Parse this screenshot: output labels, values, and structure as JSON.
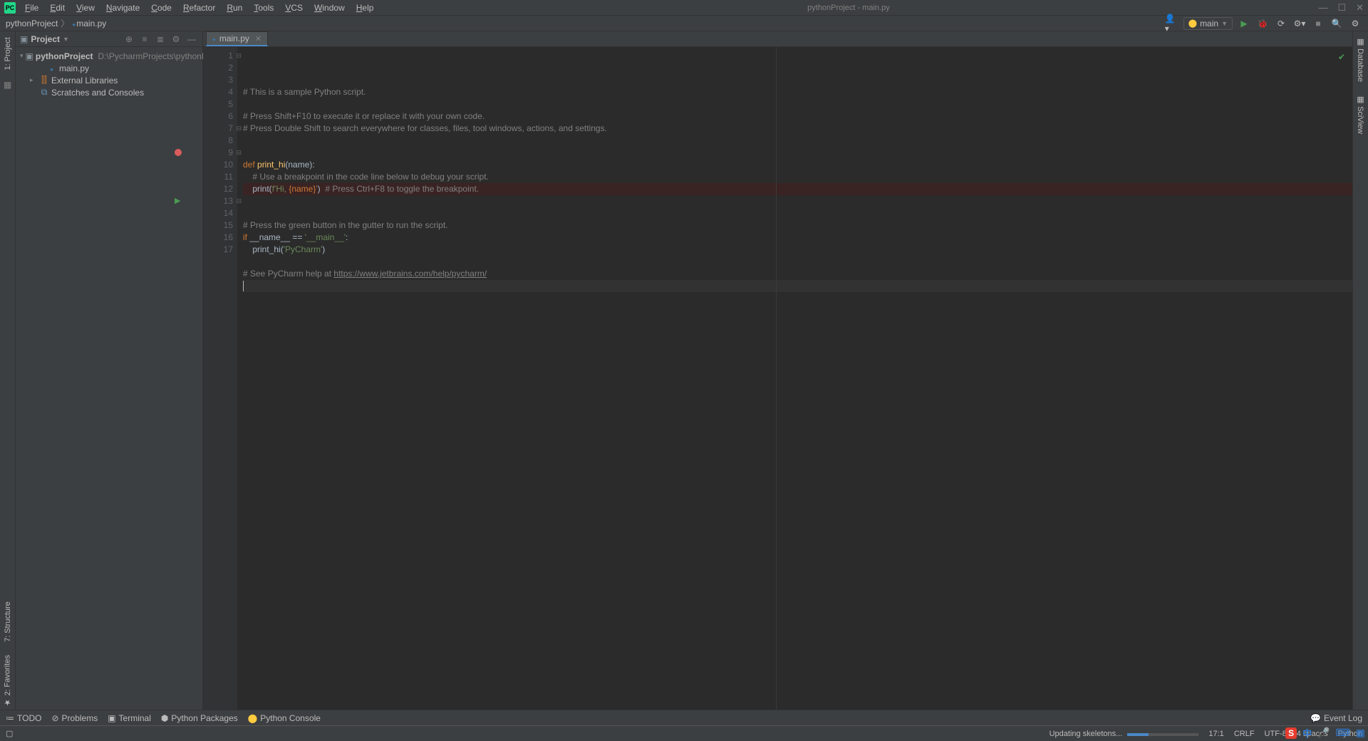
{
  "window": {
    "title": "pythonProject - main.py",
    "menus": [
      "File",
      "Edit",
      "View",
      "Navigate",
      "Code",
      "Refactor",
      "Run",
      "Tools",
      "VCS",
      "Window",
      "Help"
    ]
  },
  "breadcrumb": {
    "project": "pythonProject",
    "file": "main.py"
  },
  "runConfig": {
    "name": "main"
  },
  "projectPanel": {
    "title": "Project",
    "root": {
      "name": "pythonProject",
      "path": "D:\\PycharmProjects\\pythonProject"
    },
    "file": "main.py",
    "extLibs": "External Libraries",
    "scratches": "Scratches and Consoles"
  },
  "tabs": [
    {
      "label": "main.py",
      "active": true
    }
  ],
  "code": {
    "lines": [
      {
        "n": 1,
        "tokens": [
          {
            "t": "# This is a sample Python script.",
            "c": "c-comment"
          }
        ],
        "fold": true
      },
      {
        "n": 2,
        "tokens": []
      },
      {
        "n": 3,
        "tokens": [
          {
            "t": "# Press Shift+F10 to execute it or replace it with your own code.",
            "c": "c-comment"
          }
        ]
      },
      {
        "n": 4,
        "tokens": [
          {
            "t": "# Press Double Shift to search everywhere for classes, files, tool windows, actions, and settings.",
            "c": "c-comment"
          }
        ]
      },
      {
        "n": 5,
        "tokens": []
      },
      {
        "n": 6,
        "tokens": []
      },
      {
        "n": 7,
        "tokens": [
          {
            "t": "def ",
            "c": "c-kw"
          },
          {
            "t": "print_hi",
            "c": "c-fn"
          },
          {
            "t": "(name):",
            "c": ""
          }
        ],
        "fold": true
      },
      {
        "n": 8,
        "tokens": [
          {
            "t": "    # Use a breakpoint in the code line below to debug your script.",
            "c": "c-comment"
          }
        ]
      },
      {
        "n": 9,
        "tokens": [
          {
            "t": "    print(",
            "c": ""
          },
          {
            "t": "f'Hi, ",
            "c": "c-str"
          },
          {
            "t": "{name}",
            "c": "c-kw"
          },
          {
            "t": "'",
            "c": "c-str"
          },
          {
            "t": ")  ",
            "c": ""
          },
          {
            "t": "# Press Ctrl+F8 to toggle the breakpoint.",
            "c": "c-comment"
          }
        ],
        "bp": true,
        "fold": true
      },
      {
        "n": 10,
        "tokens": []
      },
      {
        "n": 11,
        "tokens": []
      },
      {
        "n": 12,
        "tokens": [
          {
            "t": "# Press the green button in the gutter to run the script.",
            "c": "c-comment"
          }
        ]
      },
      {
        "n": 13,
        "tokens": [
          {
            "t": "if ",
            "c": "c-kw"
          },
          {
            "t": "__name__ == ",
            "c": ""
          },
          {
            "t": "'__main__'",
            "c": "c-str"
          },
          {
            "t": ":",
            "c": ""
          }
        ],
        "run": true,
        "fold": true
      },
      {
        "n": 14,
        "tokens": [
          {
            "t": "    print_hi(",
            "c": ""
          },
          {
            "t": "'PyCharm'",
            "c": "c-str"
          },
          {
            "t": ")",
            "c": ""
          }
        ]
      },
      {
        "n": 15,
        "tokens": []
      },
      {
        "n": 16,
        "tokens": [
          {
            "t": "# See PyCharm help at ",
            "c": "c-comment"
          },
          {
            "t": "https://www.jetbrains.com/help/pycharm/",
            "c": "c-link"
          }
        ]
      },
      {
        "n": 17,
        "tokens": [],
        "cursor": true
      }
    ]
  },
  "leftRail": {
    "project": "Project",
    "structure": "Structure",
    "favorites": "Favorites"
  },
  "rightRail": {
    "database": "Database",
    "sciview": "SciView"
  },
  "bottomTools": {
    "todo": "TODO",
    "problems": "Problems",
    "terminal": "Terminal",
    "packages": "Python Packages",
    "console": "Python Console",
    "eventLog": "Event Log"
  },
  "status": {
    "bgTask": "Updating skeletons...",
    "pos": "17:1",
    "lineSep": "CRLF",
    "encoding": "UTF-8",
    "indent": "4 spaces",
    "interp": "Python"
  }
}
